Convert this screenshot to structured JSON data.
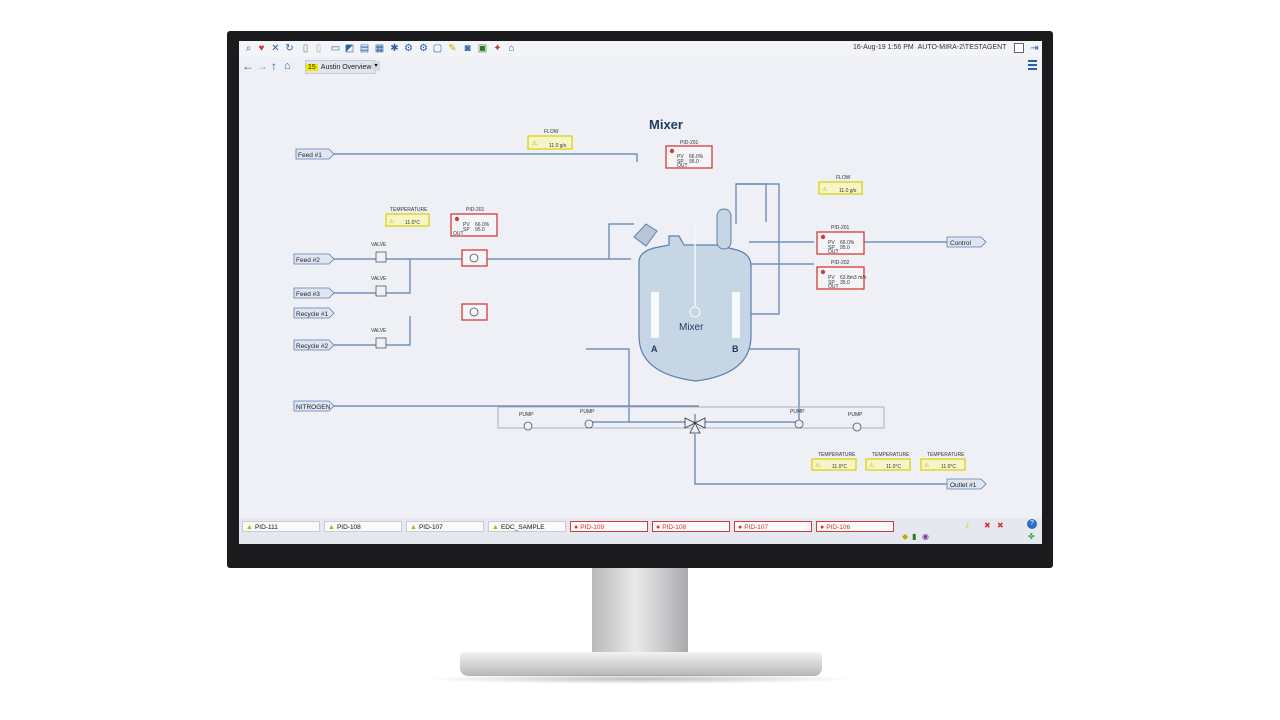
{
  "toolbar": {
    "icons": [
      "search-icon",
      "heart-icon",
      "tools-icon",
      "refresh-icon",
      "document-icon",
      "blank-doc-icon",
      "display-icon",
      "trend-icon",
      "chart-icon",
      "grid-icon",
      "alarm-icon",
      "settings-icon",
      "window-icon",
      "camera-icon",
      "highlight-icon",
      "image-icon",
      "trend-pen-icon",
      "report-icon"
    ],
    "datetime": "16-Aug-19 1:56 PM",
    "user": "AUTO-MIRA-2\\TESTAGENT"
  },
  "nav": {
    "display_number": "15",
    "display_name": "Austin Overview"
  },
  "diagram": {
    "title": "Mixer",
    "vessel_label": "Mixer",
    "vessel_left": "A",
    "vessel_right": "B",
    "inlets": [
      "Feed #1",
      "Feed #2",
      "Feed #3",
      "Recycle #1",
      "Recycle #2",
      "NITROGEN"
    ],
    "outlets": [
      "Control",
      "Outlet #1"
    ],
    "valve_label": "VALVE",
    "pump_label": "PUMP",
    "flow_label": "FLOW",
    "temperature_label": "TEMPERATURE",
    "flow_value": "11.0 g/s",
    "temp_value": "11.0°C",
    "pid_201_left": {
      "title": "PID-201",
      "pv": "66.0%",
      "sp": "95.0",
      "out": "OUT"
    },
    "pid_201_top": {
      "title": "PID-201",
      "pv": "66.0%",
      "sp": "95.0",
      "out": "OUT"
    },
    "pid_201_right": {
      "title": "PID-201",
      "pv": "66.0%",
      "sp": "95.0",
      "out": "OUT"
    },
    "pid_202": {
      "title": "PID-202",
      "pv": "63.8m3 m/h",
      "sp": "35.0",
      "out": "OUT"
    },
    "pv_label": "PV",
    "sp_label": "SP"
  },
  "tabs": [
    {
      "label": "PID-111",
      "state": "warning"
    },
    {
      "label": "PID-108",
      "state": "warning"
    },
    {
      "label": "PID-107",
      "state": "warning"
    },
    {
      "label": "EDC_SAMPLE",
      "state": "warning"
    },
    {
      "label": "PID-109",
      "state": "alarm"
    },
    {
      "label": "PID-108",
      "state": "alarm"
    },
    {
      "label": "PID-107",
      "state": "alarm"
    },
    {
      "label": "PID-106",
      "state": "alarm"
    }
  ],
  "colors": {
    "pipe": "#5b7fb0",
    "alarm": "#d23b3b",
    "warning": "#e6e600",
    "vessel": "#c7d6e4"
  }
}
